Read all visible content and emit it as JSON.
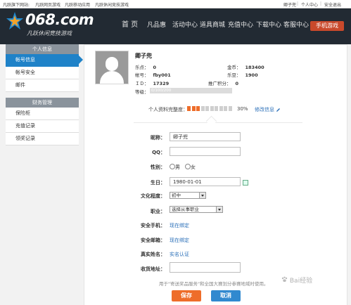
{
  "topbar": {
    "left_links": [
      "凡跃旗下网站:",
      "凡跃网页游戏",
      "凡跃移动应用",
      "凡跃休闲竞技游戏"
    ],
    "right_links": [
      "卿子兜",
      "个人中心",
      "安全退出"
    ],
    "separator": "|"
  },
  "header": {
    "logo_text": "068.com",
    "logo_subtitle": "凡跃休闲竞技游戏",
    "nav": [
      "首 页",
      "凡品惠",
      "活动中心",
      "道具商城",
      "充值中心",
      "下载中心",
      "客服中心"
    ],
    "mobile_button": "手机游戏"
  },
  "sidebar": {
    "sections": [
      {
        "title": "个人信息",
        "items": [
          "帐号信息",
          "帐号安全",
          "邮件"
        ],
        "active": 0
      },
      {
        "title": "财务管理",
        "items": [
          "保险柜",
          "充值记录",
          "领奖记录"
        ],
        "active": -1
      }
    ]
  },
  "profile": {
    "username": "卿子兜",
    "fields": {
      "lepoint_label": "乐点：",
      "lepoint": "0",
      "gold_label": "金币：",
      "gold": "183400",
      "account_label": "帐号：",
      "account": "fby001",
      "ledou_label": "乐豆：",
      "ledou": "1900",
      "id_label": "ＩＤ：",
      "id": "17329",
      "promo_label": "推广积分：",
      "promo": "0",
      "level_label": "等级：",
      "level": "0/100/200"
    },
    "completion_label": "个人资料完整度：",
    "completion_percent": 30,
    "completion_percent_text": "30%",
    "edit_link": "修改信息"
  },
  "form": {
    "nickname_label": "昵称：",
    "nickname": "卿子兜",
    "qq_label": "QQ：",
    "qq": "",
    "gender_label": "性别：",
    "gender_male": "男",
    "gender_female": "女",
    "birthday_label": "生日：",
    "birthday": "1980-01-01",
    "education_label": "文化程度：",
    "education": "初中",
    "job_label": "职业：",
    "job": "选择从事职业",
    "phone_label": "安全手机：",
    "phone_link": "现在绑定",
    "email_label": "安全邮箱：",
    "email_link": "现在绑定",
    "realname_label": "真实姓名：",
    "realname_link": "实名认证",
    "address_label": "收货地址：",
    "address": ""
  },
  "note": "用于\"寄送奖品服务\"和全国大赛划分参赛地域时使用。",
  "buttons": {
    "save": "保存",
    "cancel": "取消"
  },
  "watermark": "Bai经验",
  "colors": {
    "accent_orange": "#ee6d2a",
    "accent_blue": "#1f82c8",
    "header_bg": "#222a33"
  }
}
